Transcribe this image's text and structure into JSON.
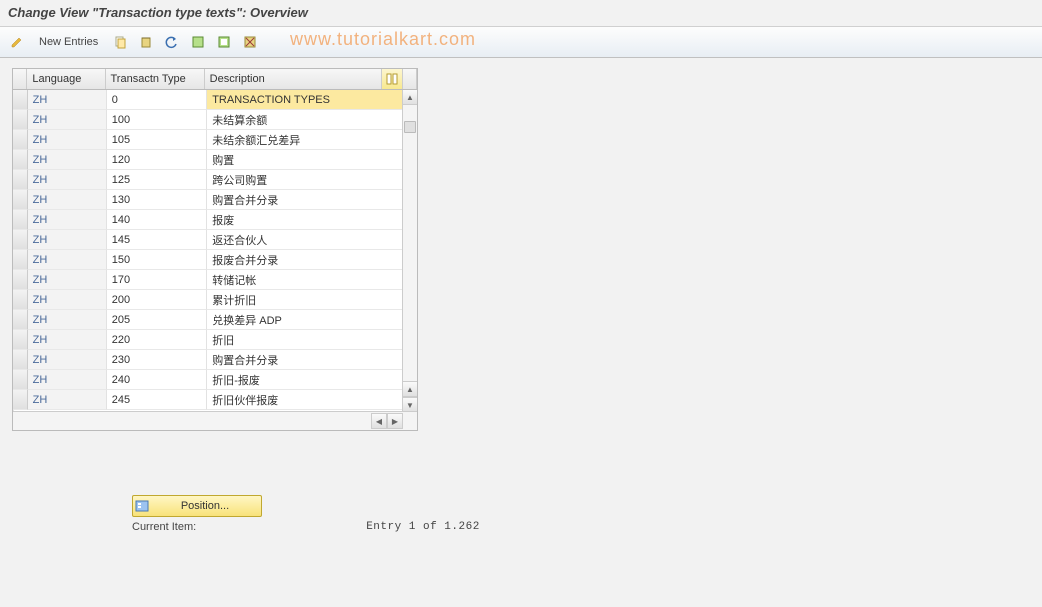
{
  "title": "Change View \"Transaction type texts\": Overview",
  "watermark": "www.tutorialkart.com",
  "toolbar": {
    "new_entries_label": "New Entries"
  },
  "columns": {
    "language": "Language",
    "transactn_type": "Transactn Type",
    "description": "Description"
  },
  "rows": [
    {
      "lang": "ZH",
      "type": "0",
      "desc": "TRANSACTION TYPES",
      "selected": true
    },
    {
      "lang": "ZH",
      "type": "100",
      "desc": "未结算余额"
    },
    {
      "lang": "ZH",
      "type": "105",
      "desc": "未结余额汇兑差异"
    },
    {
      "lang": "ZH",
      "type": "120",
      "desc": "购置"
    },
    {
      "lang": "ZH",
      "type": "125",
      "desc": "跨公司购置"
    },
    {
      "lang": "ZH",
      "type": "130",
      "desc": "购置合并分录"
    },
    {
      "lang": "ZH",
      "type": "140",
      "desc": "报废"
    },
    {
      "lang": "ZH",
      "type": "145",
      "desc": "返还合伙人"
    },
    {
      "lang": "ZH",
      "type": "150",
      "desc": "报废合并分录"
    },
    {
      "lang": "ZH",
      "type": "170",
      "desc": "转储记帐"
    },
    {
      "lang": "ZH",
      "type": "200",
      "desc": "累计折旧"
    },
    {
      "lang": "ZH",
      "type": "205",
      "desc": "兑换差异 ADP"
    },
    {
      "lang": "ZH",
      "type": "220",
      "desc": "折旧"
    },
    {
      "lang": "ZH",
      "type": "230",
      "desc": "购置合并分录"
    },
    {
      "lang": "ZH",
      "type": "240",
      "desc": "折旧-报废"
    },
    {
      "lang": "ZH",
      "type": "245",
      "desc": "折旧伙伴报废"
    }
  ],
  "footer": {
    "position_label": "Position...",
    "current_item_label": "Current Item:",
    "entry_count": "Entry 1 of 1.262"
  }
}
